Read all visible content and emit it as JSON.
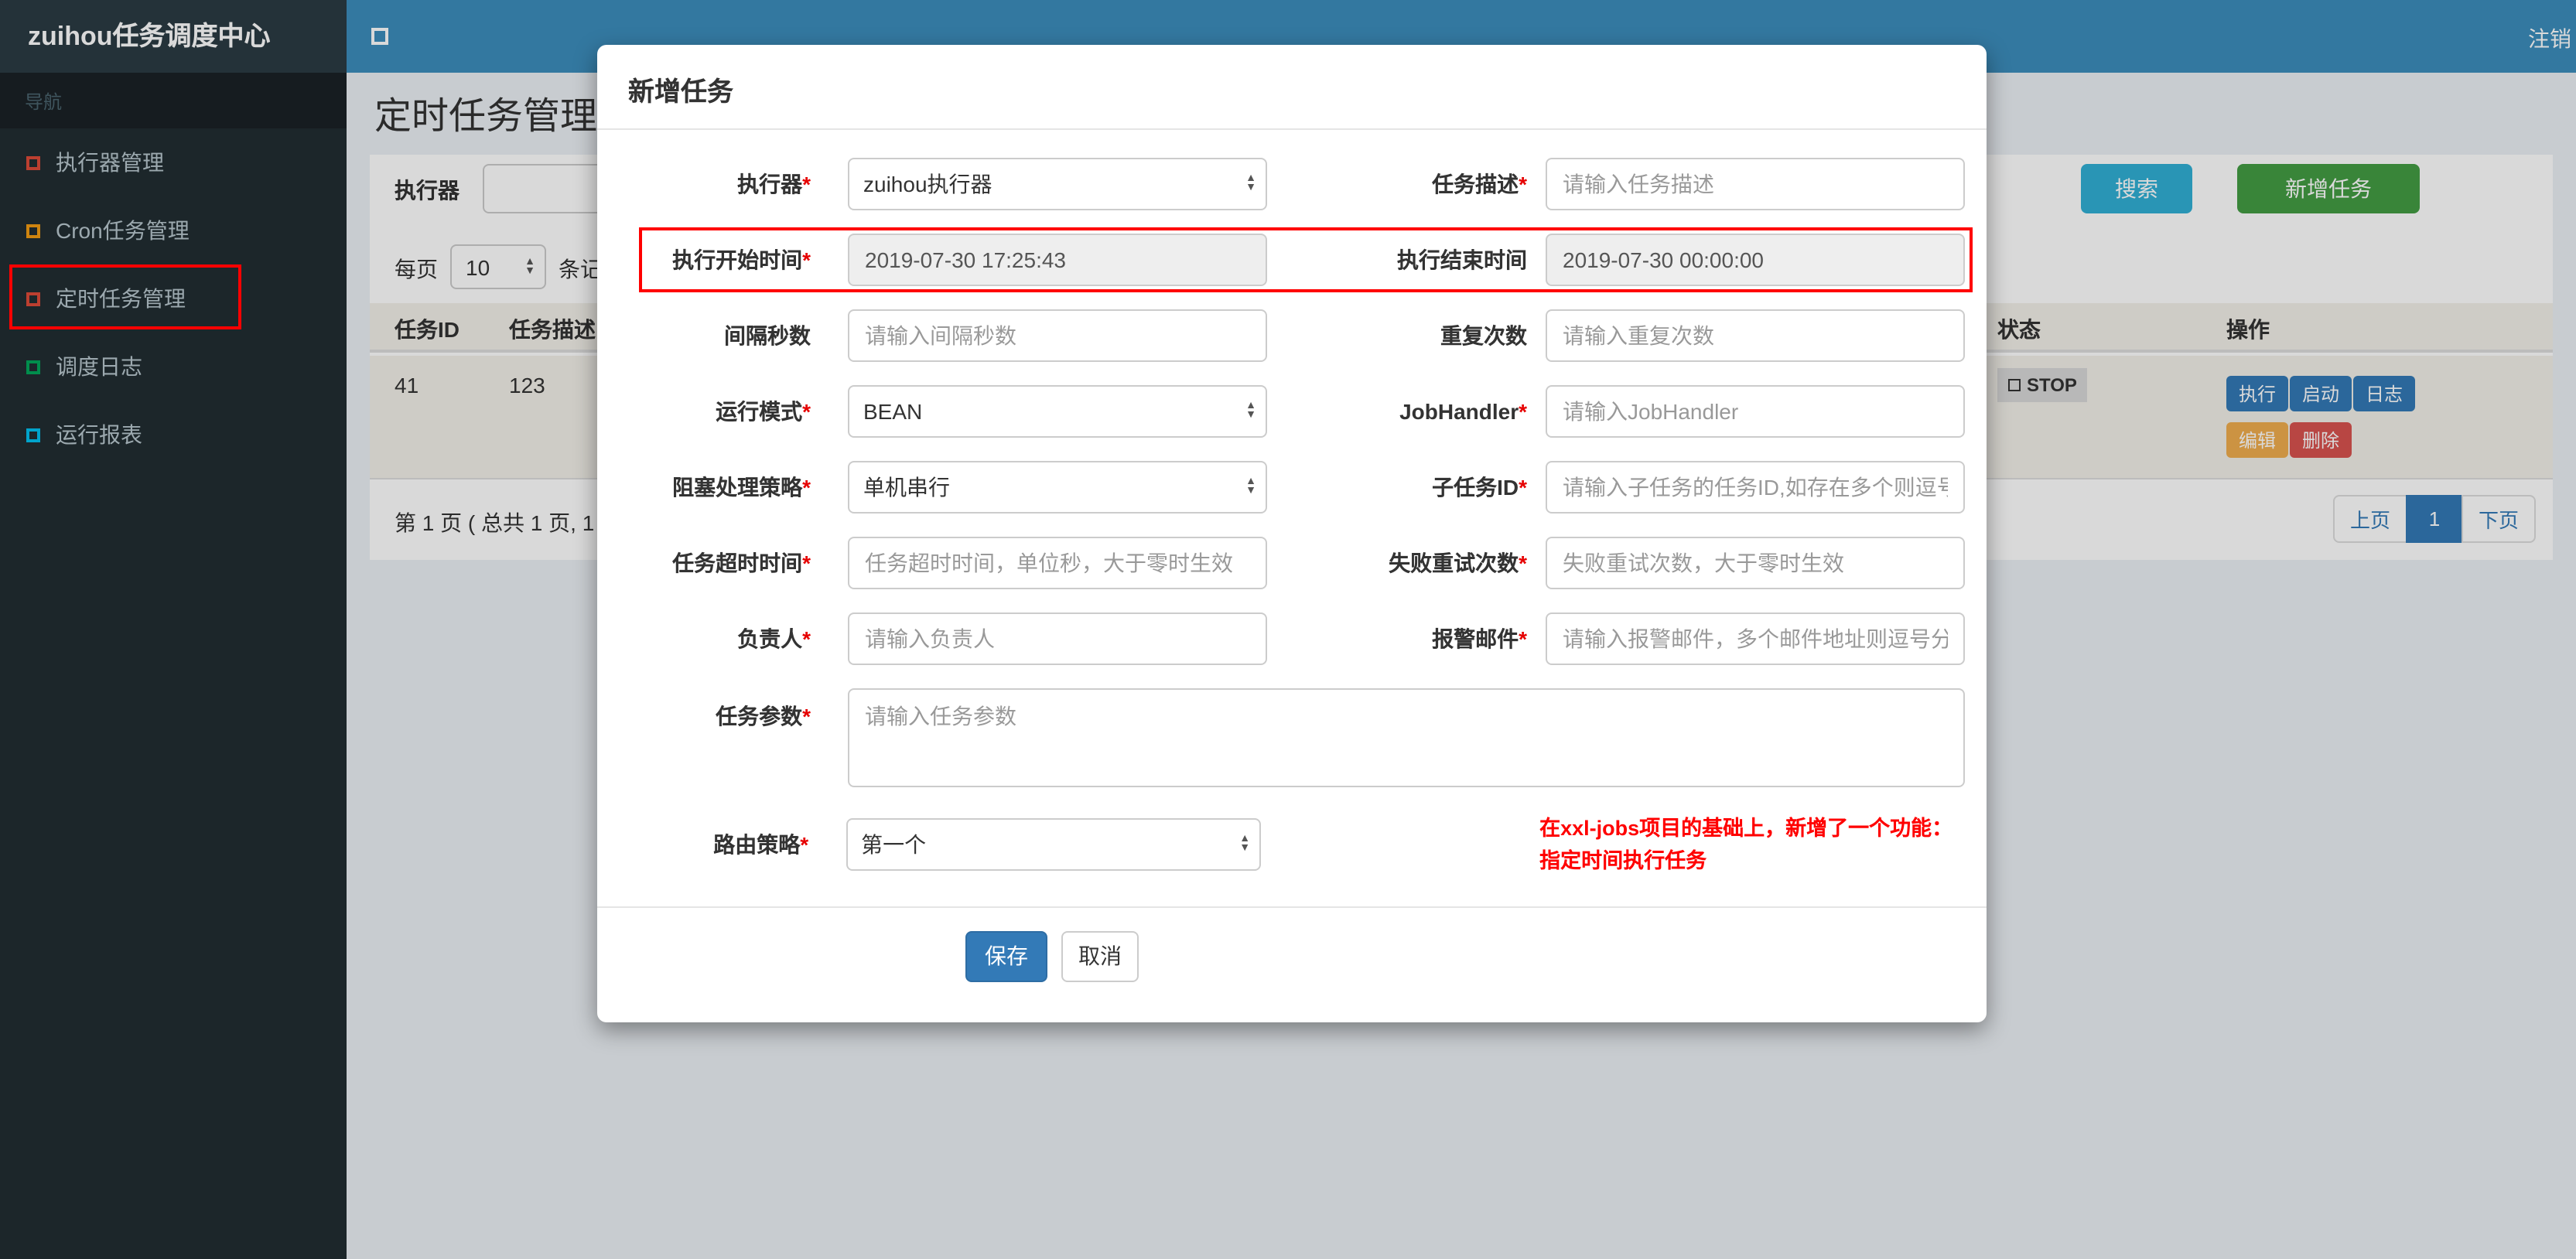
{
  "colors": {
    "navbar": "#3c8dbc",
    "brand_bg": "#2b3b44",
    "sidebar_bg": "#222d32",
    "search_button": "#31b0d5",
    "add_button": "#449d44",
    "save_button": "#337ab7",
    "annotation": "#ff0000",
    "status_badge_bg": "#d9d9d9"
  },
  "brand": {
    "title": "zuihou任务调度中心",
    "logout": "注销"
  },
  "sidebar": {
    "nav_header": "导航",
    "items": [
      {
        "label": "执行器管理",
        "icon": "square-outline-icon",
        "icon_color": "#dd4b39"
      },
      {
        "label": "Cron任务管理",
        "icon": "square-outline-icon",
        "icon_color": "#f39c12"
      },
      {
        "label": "定时任务管理",
        "icon": "square-outline-icon",
        "icon_color": "#dd4b39"
      },
      {
        "label": "调度日志",
        "icon": "square-outline-icon",
        "icon_color": "#00a65a"
      },
      {
        "label": "运行报表",
        "icon": "square-outline-icon",
        "icon_color": "#00c0ef"
      }
    ]
  },
  "page": {
    "title": "定时任务管理",
    "toolbar": {
      "executor_label": "执行器",
      "search_button": "搜索",
      "add_button": "新增任务"
    },
    "per_page": {
      "prefix": "每页",
      "value": "10",
      "suffix": "条记"
    },
    "table": {
      "headers": [
        "任务ID",
        "任务描述",
        "状态",
        "操作"
      ],
      "row": {
        "id": "41",
        "desc": "123",
        "status": "STOP",
        "actions": {
          "run": "执行",
          "start": "启动",
          "log": "日志",
          "edit": "编辑",
          "delete": "删除"
        }
      }
    },
    "pagination": {
      "summary": "第 1 页 ( 总共 1 页, 1",
      "prev": "上页",
      "current": "1",
      "next": "下页"
    }
  },
  "modal": {
    "title": "新增任务",
    "fields": {
      "executor": {
        "label": "执行器",
        "star": "*",
        "value": "zuihou执行器"
      },
      "task_desc": {
        "label": "任务描述",
        "star": "*",
        "placeholder": "请输入任务描述"
      },
      "start_time": {
        "label": "执行开始时间",
        "star": "*",
        "value": "2019-07-30 17:25:43"
      },
      "end_time": {
        "label": "执行结束时间",
        "star": "",
        "value": "2019-07-30 00:00:00"
      },
      "interval": {
        "label": "间隔秒数",
        "star": "",
        "placeholder": "请输入间隔秒数"
      },
      "repeat": {
        "label": "重复次数",
        "star": "",
        "placeholder": "请输入重复次数"
      },
      "run_mode": {
        "label": "运行模式",
        "star": "*",
        "value": "BEAN"
      },
      "job_handler": {
        "label": "JobHandler",
        "star": "*",
        "placeholder": "请输入JobHandler"
      },
      "block_strategy": {
        "label": "阻塞处理策略",
        "star": "*",
        "value": "单机串行"
      },
      "child_job": {
        "label": "子任务ID",
        "star": "*",
        "placeholder": "请输入子任务的任务ID,如存在多个则逗号分隔"
      },
      "timeout": {
        "label": "任务超时时间",
        "star": "*",
        "placeholder": "任务超时时间，单位秒，大于零时生效"
      },
      "retry": {
        "label": "失败重试次数",
        "star": "*",
        "placeholder": "失败重试次数，大于零时生效"
      },
      "owner": {
        "label": "负责人",
        "star": "*",
        "placeholder": "请输入负责人"
      },
      "alarm_email": {
        "label": "报警邮件",
        "star": "*",
        "placeholder": "请输入报警邮件，多个邮件地址则逗号分隔"
      },
      "job_param": {
        "label": "任务参数",
        "star": "*",
        "placeholder": "请输入任务参数"
      },
      "route_strategy": {
        "label": "路由策略",
        "star": "*",
        "value": "第一个"
      }
    },
    "note": "在xxl-jobs项目的基础上，新增了一个功能：\n指定时间执行任务",
    "save_button": "保存",
    "cancel_button": "取消"
  }
}
